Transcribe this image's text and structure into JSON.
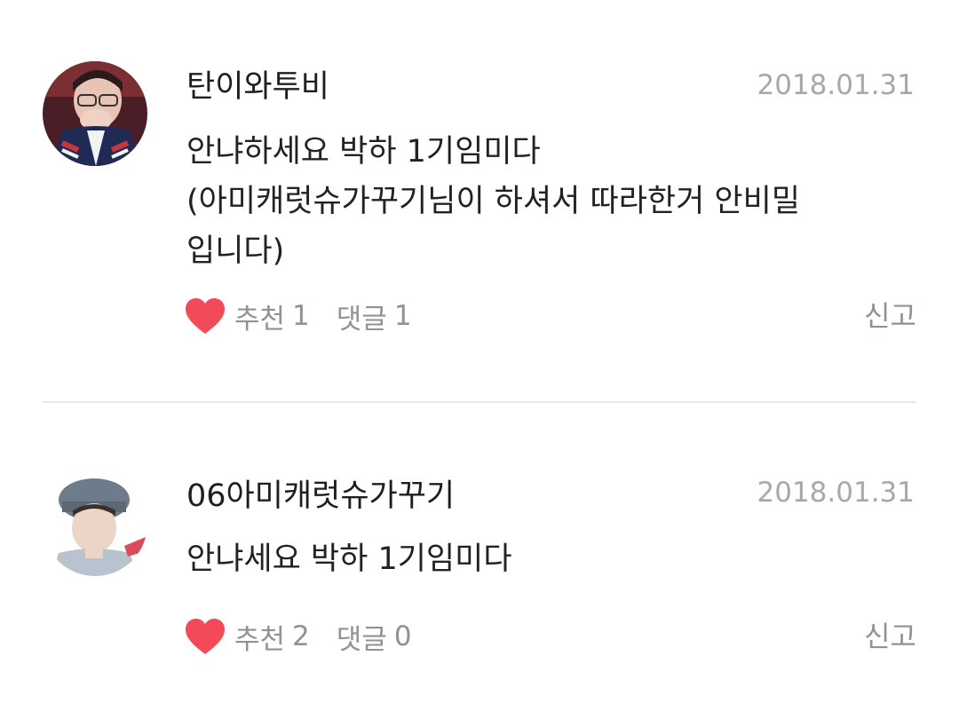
{
  "comments": [
    {
      "author": "탄이와투비",
      "date": "2018.01.31",
      "lines": [
        "안냐하세요 박하 1기임미다",
        "(아미캐럿슈가꾸기님이 하셔서 따라한거 안비밀",
        "입니다)"
      ],
      "like_label": "추천",
      "like_count": "1",
      "reply_label": "댓글",
      "reply_count": "1",
      "report_label": "신고"
    },
    {
      "author": "06아미캐럿슈가꾸기",
      "date": "2018.01.31",
      "lines": [
        "안냐세요 박하 1기임미다"
      ],
      "like_label": "추천",
      "like_count": "2",
      "reply_label": "댓글",
      "reply_count": "0",
      "report_label": "신고"
    }
  ],
  "colors": {
    "heart": "#f24b57",
    "meta_text": "#8e9397",
    "date_text": "#a5a9ad",
    "divider": "#e6e8ea"
  }
}
